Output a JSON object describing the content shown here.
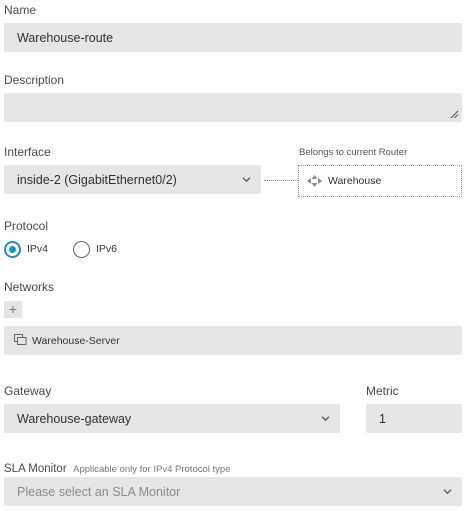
{
  "name": {
    "label": "Name",
    "value": "Warehouse-route"
  },
  "description": {
    "label": "Description",
    "value": ""
  },
  "interface": {
    "label": "Interface",
    "value": "inside-2 (GigabitEthernet0/2)",
    "belongs_label": "Belongs to current Router",
    "router_name": "Warehouse"
  },
  "protocol": {
    "label": "Protocol",
    "options": [
      {
        "label": "IPv4",
        "selected": true
      },
      {
        "label": "IPv6",
        "selected": false
      }
    ]
  },
  "networks": {
    "label": "Networks",
    "add_label": "+",
    "items": [
      {
        "label": "Warehouse-Server"
      }
    ]
  },
  "gateway": {
    "label": "Gateway",
    "value": "Warehouse-gateway"
  },
  "metric": {
    "label": "Metric",
    "value": "1"
  },
  "sla": {
    "label": "SLA Monitor",
    "hint": "Applicable only for IPv4 Protocol type",
    "placeholder": "Please select an SLA Monitor"
  },
  "colors": {
    "accent": "#1a8ec7",
    "field_bg": "#e6e6e6"
  },
  "icons": {
    "router": "router-icon",
    "network_object": "network-object-icon",
    "chevron": "chevron-down-icon",
    "resize": "resize-handle-icon"
  }
}
